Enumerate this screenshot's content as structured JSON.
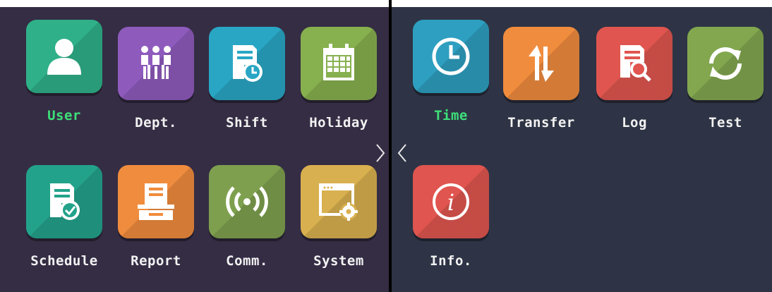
{
  "left_panel": {
    "apps": [
      {
        "label": "User",
        "icon": "user-icon",
        "color": "#2fb089",
        "active": true
      },
      {
        "label": "Dept.",
        "icon": "department-icon",
        "color": "#8e5bbd",
        "active": false
      },
      {
        "label": "Shift",
        "icon": "shift-icon",
        "color": "#29a6c4",
        "active": false
      },
      {
        "label": "Holiday",
        "icon": "calendar-icon",
        "color": "#87b04e",
        "active": false
      },
      {
        "label": "Schedule",
        "icon": "schedule-icon",
        "color": "#23a28b",
        "active": false
      },
      {
        "label": "Report",
        "icon": "report-icon",
        "color": "#f08c3e",
        "active": false
      },
      {
        "label": "Comm.",
        "icon": "wireless-icon",
        "color": "#7ea04e",
        "active": false
      },
      {
        "label": "System",
        "icon": "system-window-icon",
        "color": "#d9b04f",
        "active": false
      }
    ],
    "next_icon": "chevron-right-icon"
  },
  "right_panel": {
    "apps": [
      {
        "label": "Time",
        "icon": "clock-icon",
        "color": "#2e9fc0",
        "active": true
      },
      {
        "label": "Transfer",
        "icon": "transfer-arrows-icon",
        "color": "#f08c3e",
        "active": false
      },
      {
        "label": "Log",
        "icon": "log-search-icon",
        "color": "#e0554f",
        "active": false
      },
      {
        "label": "Test",
        "icon": "refresh-icon",
        "color": "#82a74f",
        "active": false
      },
      {
        "label": "Info.",
        "icon": "info-icon",
        "color": "#e0554f",
        "active": false
      }
    ],
    "prev_icon": "chevron-left-icon"
  },
  "colors": {
    "active_label": "#3ee07a",
    "label": "#f2f2f2"
  }
}
